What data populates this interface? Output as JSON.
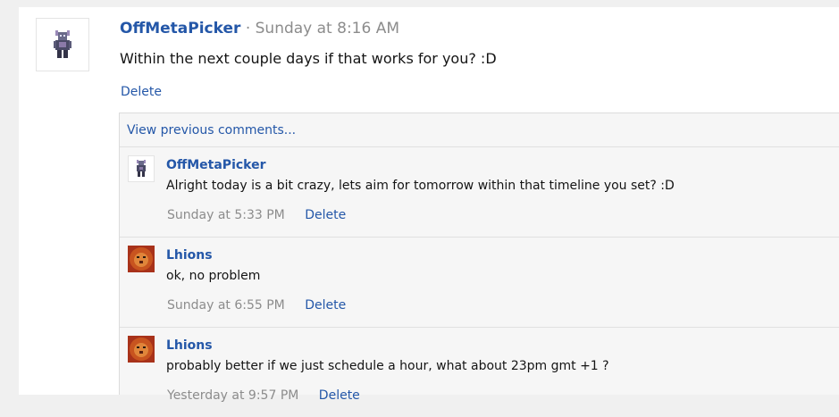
{
  "post": {
    "author": "OffMetaPicker",
    "separator": "·",
    "time": "Sunday at 8:16 AM",
    "text": "Within the next couple days if that works for you? :D",
    "delete_label": "Delete"
  },
  "comments_section": {
    "view_previous_label": "View previous comments...",
    "comments": [
      {
        "author": "OffMetaPicker",
        "text": "Alright today is a bit crazy, lets aim for tomorrow within that timeline you set? :D",
        "time": "Sunday at 5:33 PM",
        "delete_label": "Delete",
        "avatar": "armored-character-avatar"
      },
      {
        "author": "Lhions",
        "text": "ok, no problem",
        "time": "Sunday at 6:55 PM",
        "delete_label": "Delete",
        "avatar": "lion-avatar"
      },
      {
        "author": "Lhions",
        "text": "probably better if we just schedule a hour, what about 23pm gmt +1 ?",
        "time": "Yesterday at 9:57 PM",
        "delete_label": "Delete",
        "avatar": "lion-avatar"
      }
    ]
  },
  "colors": {
    "link": "#2457a8",
    "muted": "#8c8c8c",
    "background": "#f0f0f0"
  }
}
